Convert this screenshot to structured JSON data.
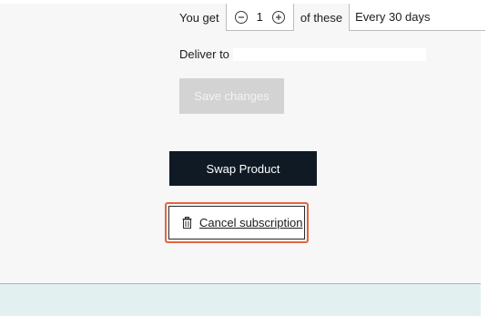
{
  "subscription": {
    "quantity_label": "You get",
    "quantity_value": "1",
    "of_these_label": "of these",
    "frequency_selected": "Every 30 days",
    "deliver_to_label": "Deliver to",
    "deliver_to_value": "",
    "save_label": "Save changes"
  },
  "actions": {
    "swap_label": "Swap Product",
    "cancel_label": "Cancel subscription"
  },
  "icons": {
    "decrement": "minus-circle-icon",
    "increment": "plus-circle-icon",
    "cancel": "trash-icon"
  },
  "colors": {
    "swap_bg": "#0f1a24",
    "save_disabled_bg": "#d3d3d3",
    "focus_outline": "#e4643f",
    "footer_bg": "#e3f0f0"
  }
}
